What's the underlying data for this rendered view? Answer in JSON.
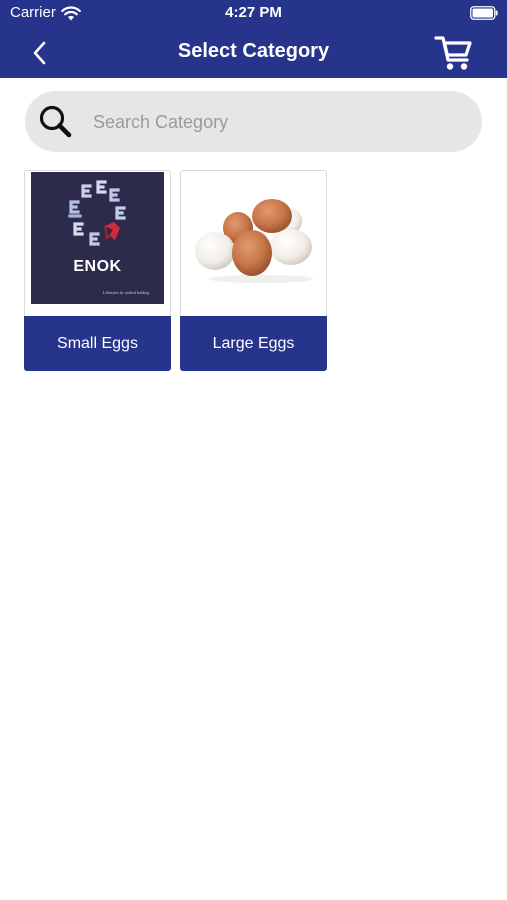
{
  "status_bar": {
    "carrier": "Carrier",
    "time": "4:27 PM"
  },
  "header": {
    "title": "Select Category",
    "back_icon": "chevron-left-icon",
    "cart_icon": "cart-icon",
    "color": "#27348b"
  },
  "search": {
    "placeholder": "Search Category",
    "value": "",
    "icon": "search-icon"
  },
  "categories": [
    {
      "label": "Small Eggs",
      "image": "enok-logo",
      "logo_text": "ENOK",
      "logo_tagline": "Lifestyles by unified holding"
    },
    {
      "label": "Large Eggs",
      "image": "eggs-photo"
    }
  ]
}
